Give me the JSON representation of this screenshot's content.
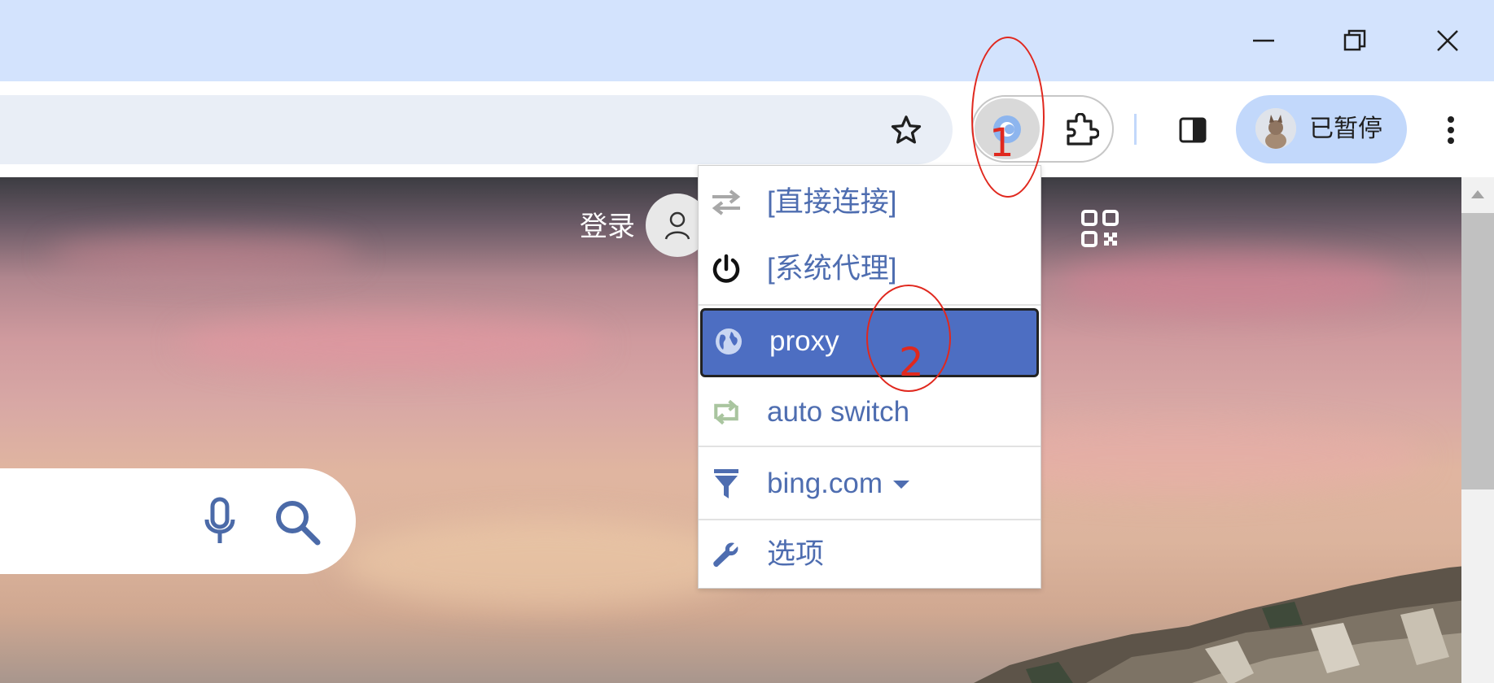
{
  "window": {
    "buttons": {
      "minimize": "minimize-icon",
      "restore": "restore-icon",
      "close": "close-icon"
    }
  },
  "toolbar": {
    "bookmark_icon": "star-icon",
    "extension_icon": "proxy-extension-icon",
    "extensions_icon": "puzzle-icon",
    "sidepanel_icon": "side-panel-icon",
    "profile_label": "已暂停",
    "menu_icon": "kebab-menu-icon"
  },
  "page": {
    "login_label": "登录",
    "qr_icon": "qr-code-icon",
    "search_mic_icon": "microphone-icon",
    "search_icon": "search-icon"
  },
  "proxy_menu": {
    "items": [
      {
        "label": "[直接连接]",
        "icon": "arrows-swap-icon"
      },
      {
        "label": "[系统代理]",
        "icon": "power-icon"
      },
      {
        "label": "proxy",
        "icon": "globe-icon",
        "selected": true
      },
      {
        "label": "auto switch",
        "icon": "retweet-icon"
      },
      {
        "label": "bing.com",
        "icon": "filter-icon",
        "has_dropdown": true
      },
      {
        "label": "选项",
        "icon": "wrench-icon"
      }
    ]
  },
  "annotations": [
    {
      "label": "1"
    },
    {
      "label": "2"
    }
  ],
  "colors": {
    "accent": "#4d6ec2",
    "menu_text": "#4e6db0",
    "annotation": "#e0281e",
    "titlebar": "#d3e3fd"
  }
}
